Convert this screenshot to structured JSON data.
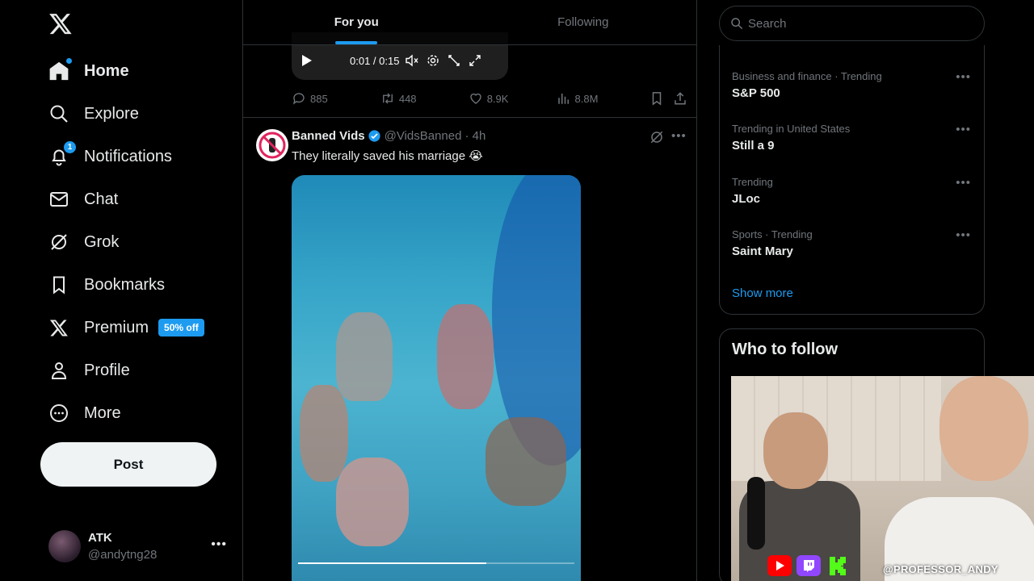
{
  "sidebar": {
    "nav": [
      {
        "label": "Home",
        "icon": "home-icon"
      },
      {
        "label": "Explore",
        "icon": "search-icon"
      },
      {
        "label": "Notifications",
        "icon": "bell-icon",
        "badge": "1"
      },
      {
        "label": "Chat",
        "icon": "mail-icon"
      },
      {
        "label": "Grok",
        "icon": "grok-icon"
      },
      {
        "label": "Bookmarks",
        "icon": "bookmark-icon"
      },
      {
        "label": "Premium",
        "icon": "x-logo-icon",
        "promo": "50% off"
      },
      {
        "label": "Profile",
        "icon": "person-icon"
      },
      {
        "label": "More",
        "icon": "more-circle-icon"
      }
    ],
    "post_label": "Post",
    "account": {
      "name": "ATK",
      "handle": "@andytng28"
    }
  },
  "tabs": [
    {
      "label": "For you",
      "active": true
    },
    {
      "label": "Following",
      "active": false
    }
  ],
  "prev_post": {
    "video_time": "0:01 / 0:15",
    "replies": "885",
    "reposts": "448",
    "likes": "8.9K",
    "views": "8.8M"
  },
  "tweet": {
    "name": "Banned Vids",
    "handle": "@VidsBanned",
    "time": "· 4h",
    "text": "They literally saved his marriage 😭",
    "video_progress": 0.68
  },
  "search": {
    "placeholder": "Search"
  },
  "trends": [
    {
      "context": "Business and finance · Trending",
      "name": "S&P 500"
    },
    {
      "context": "Trending in United States",
      "name": "Still a 9"
    },
    {
      "context": "Trending",
      "name": "JLoc"
    },
    {
      "context": "Sports · Trending",
      "name": "Saint Mary"
    }
  ],
  "show_more": "Show more",
  "who_to_follow": {
    "title": "Who to follow"
  },
  "stream": {
    "handle": "@PROFESSOR_ANDY",
    "socials": [
      "youtube-icon",
      "twitch-icon",
      "kick-icon"
    ]
  },
  "colors": {
    "accent": "#1d9bf0",
    "background": "#000000",
    "text": "#e7e9ea",
    "muted": "#71767b",
    "border": "#2f3336"
  }
}
